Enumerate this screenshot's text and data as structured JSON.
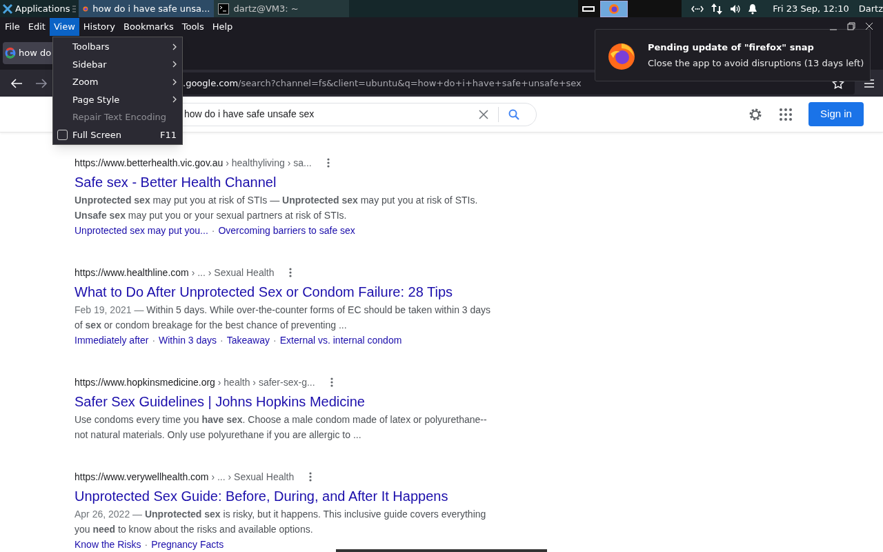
{
  "taskbar": {
    "apps_label": "Applications",
    "windows": [
      {
        "kind": "browser",
        "title": "how do i have safe unsa...",
        "selected": true
      },
      {
        "kind": "terminal",
        "title": "dartz@VM3: ~",
        "selected": false
      }
    ],
    "clock": "Fri 23 Sep, 12:10",
    "user": "Dartz"
  },
  "menubar": [
    {
      "label": "File",
      "selected": false
    },
    {
      "label": "Edit",
      "selected": false
    },
    {
      "label": "View",
      "selected": true
    },
    {
      "label": "History",
      "selected": false
    },
    {
      "label": "Bookmarks",
      "selected": false
    },
    {
      "label": "Tools",
      "selected": false
    },
    {
      "label": "Help",
      "selected": false
    }
  ],
  "view_menu": [
    {
      "kind": "submenu",
      "label": "Toolbars",
      "disabled": false
    },
    {
      "kind": "submenu",
      "label": "Sidebar",
      "disabled": false
    },
    {
      "kind": "submenu",
      "label": "Zoom",
      "disabled": false
    },
    {
      "kind": "submenu",
      "label": "Page Style",
      "disabled": false
    },
    {
      "kind": "item",
      "label": "Repair Text Encoding",
      "disabled": true
    },
    {
      "kind": "check",
      "label": "Full Screen",
      "shortcut": "F11",
      "checked": false,
      "disabled": false
    }
  ],
  "tab": {
    "title": "how do"
  },
  "address_bar": {
    "host": ".google.com",
    "path": "/search?channel=fs&client=ubuntu&q=how+do+i+have+safe+unsafe+sex"
  },
  "notification": {
    "title": "Pending update of \"firefox\" snap",
    "body": "Close the app to avoid disruptions (13 days left)"
  },
  "search": {
    "value": "how do i have safe unsafe sex",
    "sign_in": "Sign in"
  },
  "results": [
    {
      "site": "https://www.betterhealth.vic.gov.au",
      "path": " › healthyliving › sa...",
      "title": "Safe sex - Better Health Channel",
      "snippet": "**Unprotected sex** may put you at risk of STIs — **Unprotected sex** may put you at risk of STIs. **Unsafe sex** may put you or your sexual partners at risk of STIs.",
      "links": [
        {
          "kind": "link",
          "text": "Unprotected sex may put you..."
        },
        {
          "kind": "separator",
          "text": "·"
        },
        {
          "kind": "link",
          "text": "Overcoming barriers to safe sex"
        }
      ]
    },
    {
      "site": "https://www.healthline.com",
      "path": " › ... › Sexual Health",
      "title": "What to Do After Unprotected Sex or Condom Failure: 28 Tips",
      "date": "Feb 19, 2021 — ",
      "snippet": "Within 5 days. While over-the-counter forms of EC should be taken within 3 days of **sex** or condom breakage for the best chance of preventing ...",
      "links": [
        {
          "kind": "link",
          "text": "Immediately after"
        },
        {
          "kind": "separator",
          "text": "·"
        },
        {
          "kind": "link",
          "text": "Within 3 days"
        },
        {
          "kind": "separator",
          "text": "·"
        },
        {
          "kind": "link",
          "text": "Takeaway"
        },
        {
          "kind": "separator",
          "text": "·"
        },
        {
          "kind": "link",
          "text": "External vs. internal condom"
        }
      ]
    },
    {
      "site": "https://www.hopkinsmedicine.org",
      "path": " › health › safer-sex-g...",
      "title": "Safer Sex Guidelines | Johns Hopkins Medicine",
      "snippet": "Use condoms every time you **have sex**. Choose a male condom made of latex or polyurethane--not natural materials. Only use polyurethane if you are allergic to ..."
    },
    {
      "site": "https://www.verywellhealth.com",
      "path": " › ... › Sexual Health",
      "title": "Unprotected Sex Guide: Before, During, and After It Happens",
      "date": "Apr 26, 2022 — ",
      "snippet": "**Unprotected sex** is risky, but it happens. This inclusive guide covers everything you **need** to know about the risks and available options.",
      "links": [
        {
          "kind": "link",
          "text": "Know the Risks"
        },
        {
          "kind": "separator",
          "text": "·"
        },
        {
          "kind": "link",
          "text": "Pregnancy Facts"
        }
      ]
    }
  ]
}
